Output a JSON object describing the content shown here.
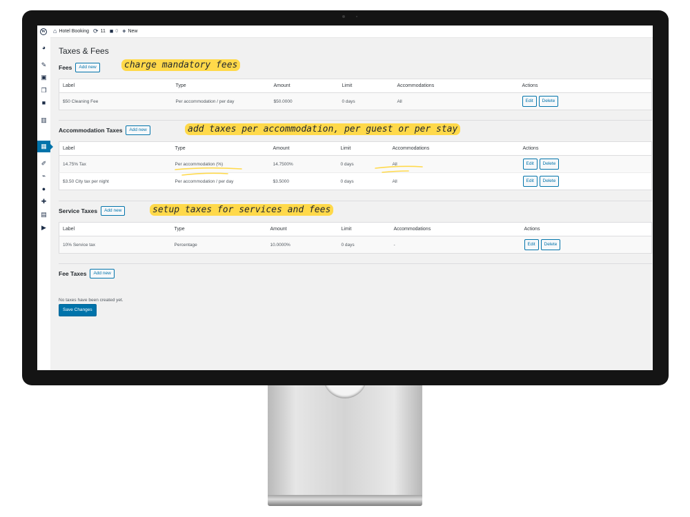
{
  "admin_bar": {
    "site_name": "Hotel Booking",
    "updates_count": "11",
    "comments_count": "0",
    "new_label": "New"
  },
  "page": {
    "title": "Taxes & Fees"
  },
  "columns": {
    "label": "Label",
    "type": "Type",
    "amount": "Amount",
    "limit": "Limit",
    "accommodations": "Accommodations",
    "actions": "Actions"
  },
  "buttons": {
    "add_new": "Add new",
    "edit": "Edit",
    "delete": "Delete",
    "save_changes": "Save Changes"
  },
  "sections": {
    "fees": {
      "title": "Fees",
      "rows": [
        {
          "label": "$50 Cleaning Fee",
          "type": "Per accommodation / per day",
          "amount": "$50.0000",
          "limit": "0 days",
          "accommodations": "All"
        }
      ]
    },
    "accommodation_taxes": {
      "title": "Accommodation Taxes",
      "rows": [
        {
          "label": "14.75% Tax",
          "type": "Per accommodation (%)",
          "amount": "14.7500%",
          "limit": "0 days",
          "accommodations": "All"
        },
        {
          "label": "$3.50 City tax per night",
          "type": "Per accommodation / per day",
          "amount": "$3.5000",
          "limit": "0 days",
          "accommodations": "All"
        }
      ]
    },
    "service_taxes": {
      "title": "Service Taxes",
      "rows": [
        {
          "label": "10% Service tax",
          "type": "Percentage",
          "amount": "10.0000%",
          "limit": "0 days",
          "accommodations": "-"
        }
      ]
    },
    "fee_taxes": {
      "title": "Fee Taxes",
      "empty_message": "No taxes have been created yet."
    }
  },
  "annotations": {
    "fees": "charge mandatory fees",
    "accommodation": "add taxes per accommodation, per guest or per stay",
    "services": "setup taxes for services and fees"
  },
  "colors": {
    "accent": "#0073aa",
    "highlight": "#ffd94a",
    "admin_background": "#f1f1f1"
  },
  "icons": {
    "admin_bar": [
      "wordpress-logo-icon",
      "home-icon",
      "updates-icon",
      "comment-icon",
      "plus-icon"
    ],
    "sidebar": [
      "dashboard-icon",
      "pin-icon",
      "media-icon",
      "pages-icon",
      "comments-icon",
      "building-icon",
      "calendar-icon",
      "appearance-icon",
      "plugins-icon",
      "users-icon",
      "tools-icon",
      "settings-icon",
      "play-icon"
    ]
  }
}
